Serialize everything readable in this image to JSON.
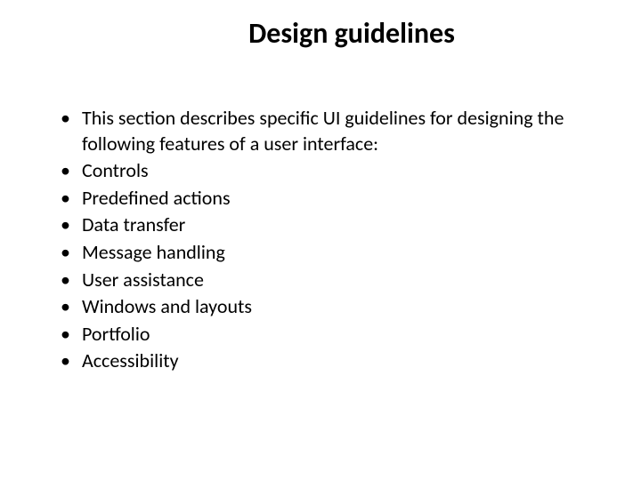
{
  "slide": {
    "title": "Design guidelines",
    "bullets": [
      "This section describes specific UI guidelines for designing the following features of a user interface:",
      "Controls",
      "Predefined actions",
      "Data transfer",
      "Message handling",
      "User assistance",
      "Windows and layouts",
      "Portfolio",
      "Accessibility"
    ]
  }
}
